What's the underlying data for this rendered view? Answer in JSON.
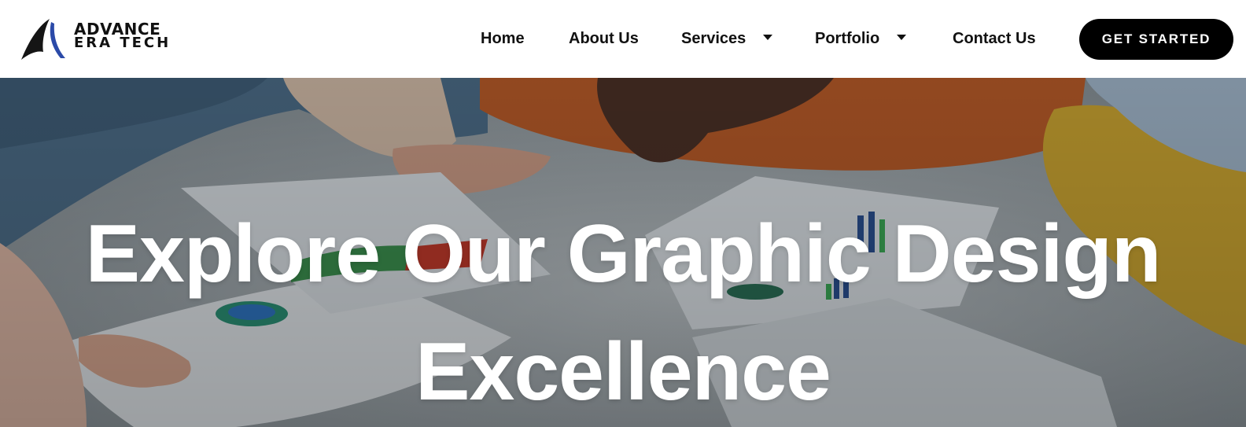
{
  "header": {
    "logo": {
      "line1": "ADVANCE",
      "line2": "ERA TECH"
    },
    "nav": [
      {
        "label": "Home",
        "has_dropdown": false
      },
      {
        "label": "About Us",
        "has_dropdown": false
      },
      {
        "label": "Services",
        "has_dropdown": true
      },
      {
        "label": "Portfolio",
        "has_dropdown": true
      },
      {
        "label": "Contact Us",
        "has_dropdown": false
      }
    ],
    "cta_label": "GET STARTED"
  },
  "hero": {
    "title_line1": "Explore Our Graphic Design",
    "title_line2": "Excellence",
    "background_icon": "team-design-workspace-photo"
  },
  "colors": {
    "text": "#111111",
    "cta_bg": "#000000",
    "cta_text": "#ffffff",
    "logo_blue": "#2b4aa8",
    "hero_text": "#ffffff"
  }
}
